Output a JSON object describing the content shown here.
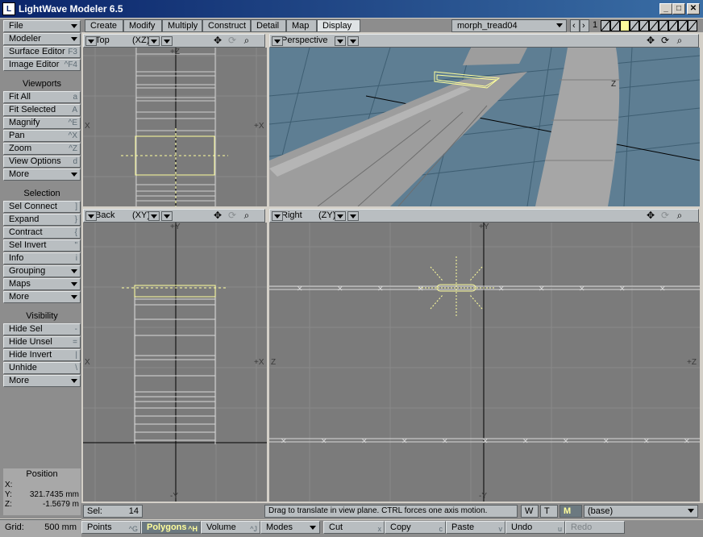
{
  "window": {
    "title": "LightWave Modeler 6.5",
    "minimize": "_",
    "maximize": "□",
    "close": "✕"
  },
  "sidebar": {
    "file": "File",
    "modeler": "Modeler",
    "surface_editor": {
      "label": "Surface Editor",
      "shortcut": "F3"
    },
    "image_editor": {
      "label": "Image Editor",
      "shortcut": "^F4"
    },
    "viewports_head": "Viewports",
    "fit_all": {
      "label": "Fit All",
      "shortcut": "a"
    },
    "fit_selected": {
      "label": "Fit Selected",
      "shortcut": "A"
    },
    "magnify": {
      "label": "Magnify",
      "shortcut": "^E"
    },
    "pan": {
      "label": "Pan",
      "shortcut": "^X"
    },
    "zoom": {
      "label": "Zoom",
      "shortcut": "^Z"
    },
    "view_options": {
      "label": "View Options",
      "shortcut": "d"
    },
    "more1": "More",
    "selection_head": "Selection",
    "sel_connect": {
      "label": "Sel Connect",
      "shortcut": "]"
    },
    "expand": {
      "label": "Expand",
      "shortcut": "}"
    },
    "contract": {
      "label": "Contract",
      "shortcut": "{"
    },
    "sel_invert": {
      "label": "Sel Invert",
      "shortcut": "\""
    },
    "info": {
      "label": "Info",
      "shortcut": "i"
    },
    "grouping": "Grouping",
    "maps": "Maps",
    "more2": "More",
    "visibility_head": "Visibility",
    "hide_sel": {
      "label": "Hide Sel",
      "shortcut": "-"
    },
    "hide_unsel": {
      "label": "Hide Unsel",
      "shortcut": "="
    },
    "hide_invert": {
      "label": "Hide Invert",
      "shortcut": "|"
    },
    "unhide": {
      "label": "Unhide",
      "shortcut": "\\"
    },
    "more3": "More",
    "position_head": "Position",
    "pos_x_label": "X:",
    "pos_y_label": "Y:",
    "pos_y_value": "321.7435 mm",
    "pos_z_label": "Z:",
    "pos_z_value": "-1.5679 m",
    "grid_label": "Grid:",
    "grid_value": "500 mm"
  },
  "tabs": [
    "Create",
    "Modify",
    "Multiply",
    "Construct",
    "Detail",
    "Map",
    "Display"
  ],
  "active_tab": "Display",
  "layer": {
    "name": "morph_tread04",
    "number": "1"
  },
  "viewports": {
    "top": {
      "name": "Top",
      "axes": "(XZ)",
      "x_neg": "X",
      "x_pos": "+X",
      "z_pos": "+Z"
    },
    "perspective": {
      "name": "Perspective",
      "axis_label": "Z"
    },
    "back": {
      "name": "Back",
      "axes": "(XY)",
      "x_neg": "X",
      "x_pos": "+X",
      "y_pos": "+Y",
      "y_neg": "-Y"
    },
    "right": {
      "name": "Right",
      "axes": "(ZY)",
      "z_neg": "Z",
      "z_pos": "+Z",
      "y_pos": "+Y",
      "y_neg": "-Y"
    }
  },
  "status": {
    "sel_label": "Sel:",
    "sel_count": "14",
    "hint": "Drag to translate in view plane. CTRL forces one axis motion.",
    "w": "W",
    "t": "T",
    "m": "M",
    "layer_select": "(base)"
  },
  "toolbar": {
    "points": {
      "label": "Points",
      "shortcut": "^G"
    },
    "polygons": {
      "label": "Polygons",
      "shortcut": "^H"
    },
    "volume": {
      "label": "Volume",
      "shortcut": "^J"
    },
    "modes": "Modes",
    "cut": {
      "label": "Cut",
      "shortcut": "x"
    },
    "copy": {
      "label": "Copy",
      "shortcut": "c"
    },
    "paste": {
      "label": "Paste",
      "shortcut": "v"
    },
    "undo": {
      "label": "Undo",
      "shortcut": "u"
    },
    "redo": {
      "label": "Redo",
      "shortcut": ""
    }
  },
  "colors": {
    "titlebar": "#0a246a",
    "viewport_bg": "#7b7b7b",
    "perspective_bg": "#5e7e93",
    "selection": "#ffff9c"
  }
}
